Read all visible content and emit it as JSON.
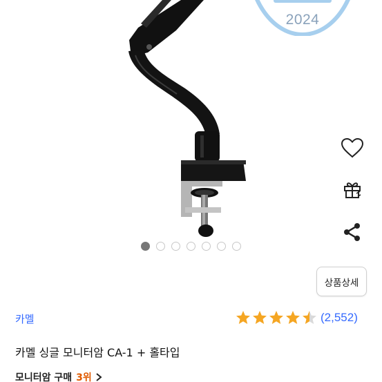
{
  "badge": {
    "year": "2024"
  },
  "gallery": {
    "total_dots": 7,
    "active_index": 0
  },
  "side_actions": [
    {
      "name": "wishlist",
      "icon": "heart-icon"
    },
    {
      "name": "gift",
      "icon": "gift-icon"
    },
    {
      "name": "share",
      "icon": "share-icon"
    }
  ],
  "detail_button": {
    "label": "상품상세"
  },
  "product": {
    "brand": "카멜",
    "title": "카멜 싱글 모니터암 CA-1 + 홀타입",
    "rating": 4.5,
    "rating_count": "(2,552)",
    "rank_category": "모니터암 구매",
    "rank_value": "3위"
  },
  "colors": {
    "link_blue": "#346aff",
    "star": "#f5a623",
    "rank_orange": "#e05a00"
  }
}
